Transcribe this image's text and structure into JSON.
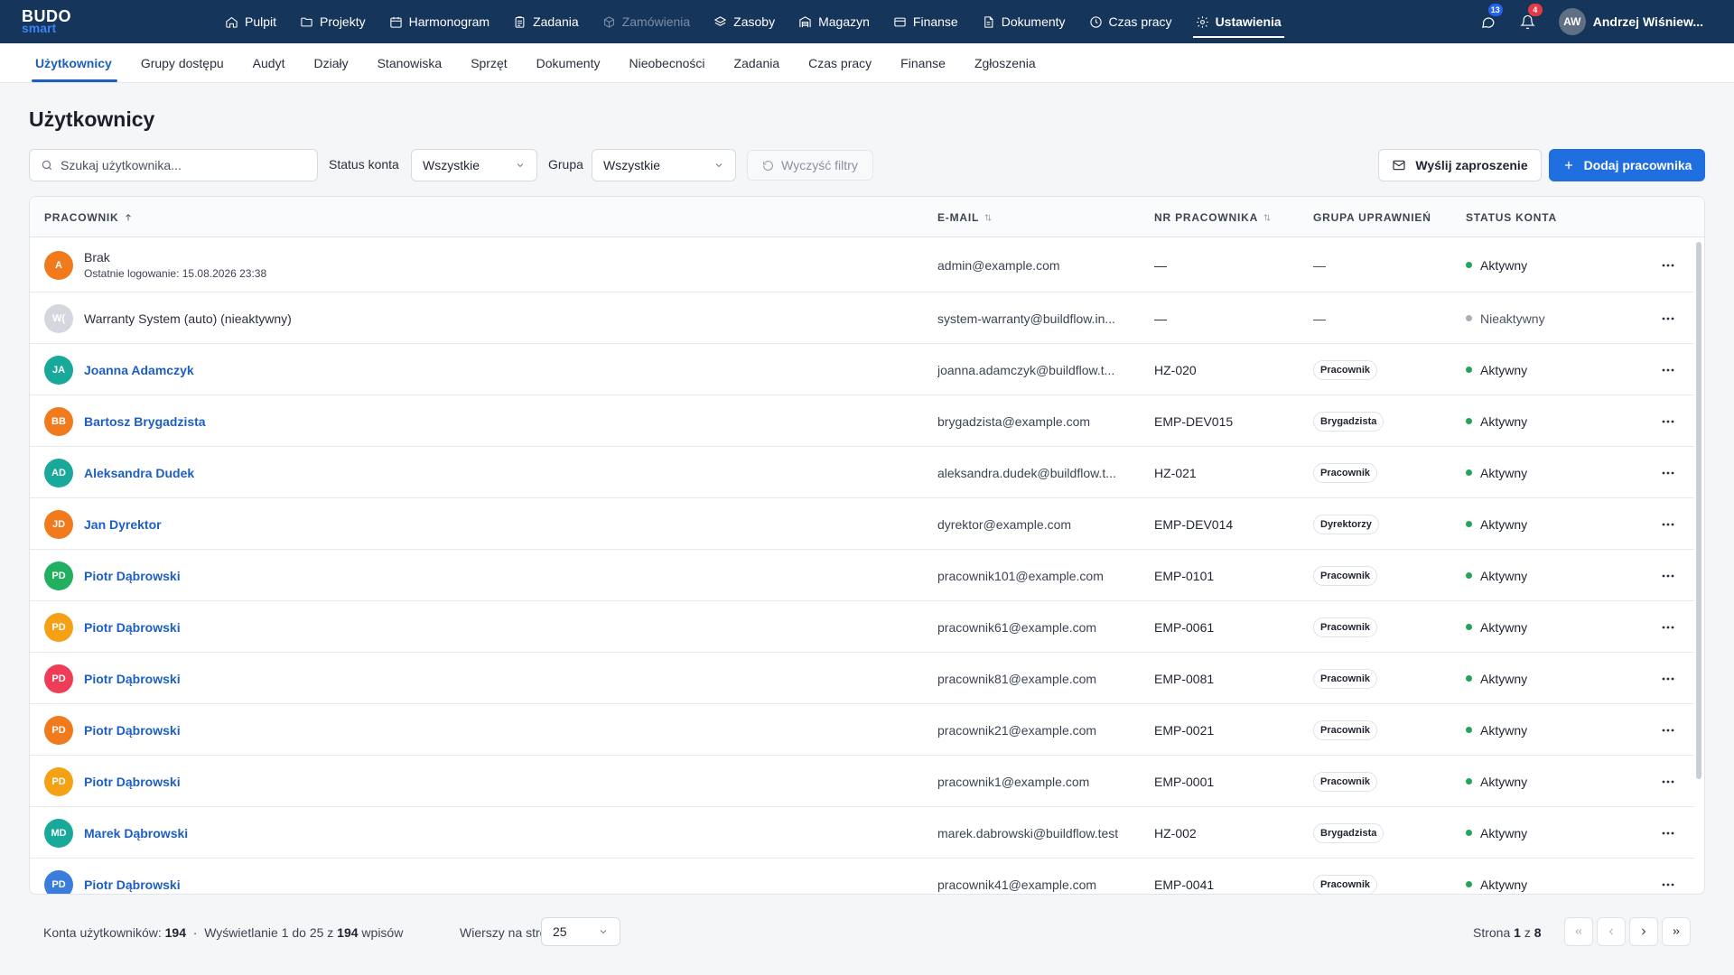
{
  "logo": {
    "line1": "BUDO",
    "line2": "smart"
  },
  "topnav": [
    {
      "label": "Pulpit",
      "icon": "home-icon"
    },
    {
      "label": "Projekty",
      "icon": "folder-icon"
    },
    {
      "label": "Harmonogram",
      "icon": "calendar-icon"
    },
    {
      "label": "Zadania",
      "icon": "clipboard-icon"
    },
    {
      "label": "Zamówienia",
      "icon": "package-icon",
      "disabled": true
    },
    {
      "label": "Zasoby",
      "icon": "layers-icon"
    },
    {
      "label": "Magazyn",
      "icon": "warehouse-icon"
    },
    {
      "label": "Finanse",
      "icon": "credit-card-icon"
    },
    {
      "label": "Dokumenty",
      "icon": "document-icon"
    },
    {
      "label": "Czas pracy",
      "icon": "clock-icon"
    },
    {
      "label": "Ustawienia",
      "icon": "gear-icon",
      "active": true
    }
  ],
  "header": {
    "messages_badge": "13",
    "notifications_badge": "4",
    "user_initials": "AW",
    "user_name": "Andrzej Wiśniew..."
  },
  "subtabs": [
    {
      "label": "Użytkownicy",
      "active": true
    },
    {
      "label": "Grupy dostępu"
    },
    {
      "label": "Audyt"
    },
    {
      "label": "Działy"
    },
    {
      "label": "Stanowiska"
    },
    {
      "label": "Sprzęt"
    },
    {
      "label": "Dokumenty"
    },
    {
      "label": "Nieobecności"
    },
    {
      "label": "Zadania"
    },
    {
      "label": "Czas pracy"
    },
    {
      "label": "Finanse"
    },
    {
      "label": "Zgłoszenia"
    }
  ],
  "page": {
    "title": "Użytkownicy"
  },
  "filters": {
    "search_placeholder": "Szukaj użytkownika...",
    "status_label": "Status konta",
    "status_value": "Wszystkie",
    "group_label": "Grupa",
    "group_value": "Wszystkie",
    "clear_label": "Wyczyść filtry",
    "invite_label": "Wyślij zaproszenie",
    "add_label": "Dodaj pracownika"
  },
  "table": {
    "columns": {
      "employee": "PRACOWNIK",
      "email": "E-MAIL",
      "empno": "NR PRACOWNIKA",
      "group": "GRUPA UPRAWNIEŃ",
      "status": "STATUS KONTA"
    },
    "rows": [
      {
        "initials": "A",
        "color": "#f07a1c",
        "name": "Brak",
        "link": false,
        "sub": "Ostatnie logowanie: 15.08.2026 23:38",
        "email": "admin@example.com",
        "empno": "—",
        "group": "—",
        "status": "Aktywny",
        "active": true
      },
      {
        "initials": "W(",
        "color": "#d4d8de",
        "name": "Warranty System (auto) (nieaktywny)",
        "link": false,
        "email": "system-warranty@buildflow.in...",
        "empno": "—",
        "group": "—",
        "status": "Nieaktywny",
        "active": false
      },
      {
        "initials": "JA",
        "color": "#19a99a",
        "name": "Joanna Adamczyk",
        "link": true,
        "email": "joanna.adamczyk@buildflow.t...",
        "empno": "HZ-020",
        "group": "Pracownik",
        "status": "Aktywny",
        "active": true
      },
      {
        "initials": "BB",
        "color": "#f07a1c",
        "name": "Bartosz Brygadzista",
        "link": true,
        "email": "brygadzista@example.com",
        "empno": "EMP-DEV015",
        "group": "Brygadzista",
        "status": "Aktywny",
        "active": true
      },
      {
        "initials": "AD",
        "color": "#19a99a",
        "name": "Aleksandra Dudek",
        "link": true,
        "email": "aleksandra.dudek@buildflow.t...",
        "empno": "HZ-021",
        "group": "Pracownik",
        "status": "Aktywny",
        "active": true
      },
      {
        "initials": "JD",
        "color": "#f07a1c",
        "name": "Jan Dyrektor",
        "link": true,
        "email": "dyrektor@example.com",
        "empno": "EMP-DEV014",
        "group": "Dyrektorzy",
        "status": "Aktywny",
        "active": true
      },
      {
        "initials": "PD",
        "color": "#22b060",
        "name": "Piotr Dąbrowski",
        "link": true,
        "email": "pracownik101@example.com",
        "empno": "EMP-0101",
        "group": "Pracownik",
        "status": "Aktywny",
        "active": true
      },
      {
        "initials": "PD",
        "color": "#f5a116",
        "name": "Piotr Dąbrowski",
        "link": true,
        "email": "pracownik61@example.com",
        "empno": "EMP-0061",
        "group": "Pracownik",
        "status": "Aktywny",
        "active": true
      },
      {
        "initials": "PD",
        "color": "#ef3d57",
        "name": "Piotr Dąbrowski",
        "link": true,
        "email": "pracownik81@example.com",
        "empno": "EMP-0081",
        "group": "Pracownik",
        "status": "Aktywny",
        "active": true
      },
      {
        "initials": "PD",
        "color": "#f07a1c",
        "name": "Piotr Dąbrowski",
        "link": true,
        "email": "pracownik21@example.com",
        "empno": "EMP-0021",
        "group": "Pracownik",
        "status": "Aktywny",
        "active": true
      },
      {
        "initials": "PD",
        "color": "#f5a116",
        "name": "Piotr Dąbrowski",
        "link": true,
        "email": "pracownik1@example.com",
        "empno": "EMP-0001",
        "group": "Pracownik",
        "status": "Aktywny",
        "active": true
      },
      {
        "initials": "MD",
        "color": "#19a99a",
        "name": "Marek Dąbrowski",
        "link": true,
        "email": "marek.dabrowski@buildflow.test",
        "empno": "HZ-002",
        "group": "Brygadzista",
        "status": "Aktywny",
        "active": true
      },
      {
        "initials": "PD",
        "color": "#3b7ddd",
        "name": "Piotr Dąbrowski",
        "link": true,
        "email": "pracownik41@example.com",
        "empno": "EMP-0041",
        "group": "Pracownik",
        "status": "Aktywny",
        "active": true
      }
    ]
  },
  "footer": {
    "accounts_label": "Konta użytkowników:",
    "accounts_count": "194",
    "separator": "·",
    "showing_prefix": "Wyświetlanie 1 do 25 z",
    "showing_total": "194",
    "showing_suffix": "wpisów",
    "rows_label": "Wierszy na stronę",
    "rows_value": "25",
    "page_prefix": "Strona",
    "page_current": "1",
    "page_mid": "z",
    "page_total": "8"
  }
}
